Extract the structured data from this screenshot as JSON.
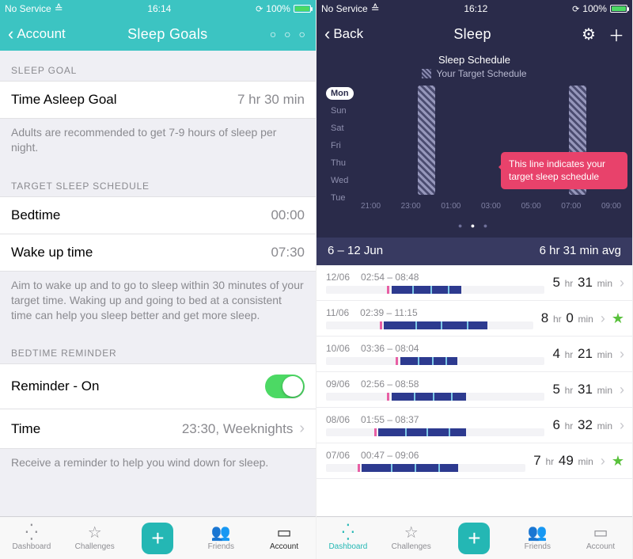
{
  "left": {
    "status": {
      "carrier": "No Service",
      "time": "16:14",
      "battery": "100%"
    },
    "nav": {
      "back": "Account",
      "title": "Sleep Goals"
    },
    "sections": {
      "sleep_goal_header": "Sleep Goal",
      "time_asleep_label": "Time Asleep Goal",
      "time_asleep_value": "7 hr 30 min",
      "sleep_goal_note": "Adults are recommended to get 7-9 hours of sleep per night.",
      "target_header": "Target Sleep Schedule",
      "bedtime_label": "Bedtime",
      "bedtime_value": "00:00",
      "wake_label": "Wake up time",
      "wake_value": "07:30",
      "target_note": "Aim to wake up and to go to sleep within 30 minutes of your target time. Waking up and going to bed at a consistent time can help you sleep better and get more sleep.",
      "reminder_header": "Bedtime Reminder",
      "reminder_label": "Reminder - On",
      "reminder_time_label": "Time",
      "reminder_time_value": "23:30, Weeknights",
      "reminder_note": "Receive a reminder to help you wind down for sleep."
    },
    "tabs": {
      "dashboard": "Dashboard",
      "challenges": "Challenges",
      "friends": "Friends",
      "account": "Account"
    }
  },
  "right": {
    "status": {
      "carrier": "No Service",
      "time": "16:12",
      "battery": "100%"
    },
    "nav": {
      "back": "Back",
      "title": "Sleep"
    },
    "panel": {
      "subtitle": "Sleep Schedule",
      "legend": "Your Target Schedule",
      "days": [
        "Mon",
        "Sun",
        "Sat",
        "Fri",
        "Thu",
        "Wed",
        "Tue"
      ],
      "xticks": [
        "21:00",
        "23:00",
        "01:00",
        "03:00",
        "05:00",
        "07:00",
        "09:00"
      ],
      "callout": "This line indicates your target sleep schedule",
      "summary_range": "6 – 12 Jun",
      "summary_avg": "6 hr 31 min avg"
    },
    "entries": [
      {
        "date": "12/06",
        "range": "02:54 – 08:48",
        "h": "5",
        "m": "31",
        "star": false,
        "start": 30,
        "len": 32
      },
      {
        "date": "11/06",
        "range": "02:39 – 11:15",
        "h": "8",
        "m": "0",
        "star": true,
        "start": 28,
        "len": 50
      },
      {
        "date": "10/06",
        "range": "03:36 – 08:04",
        "h": "4",
        "m": "21",
        "star": false,
        "start": 34,
        "len": 26
      },
      {
        "date": "09/06",
        "range": "02:56 – 08:58",
        "h": "5",
        "m": "31",
        "star": false,
        "start": 30,
        "len": 34
      },
      {
        "date": "08/06",
        "range": "01:55 – 08:37",
        "h": "6",
        "m": "32",
        "star": false,
        "start": 24,
        "len": 40
      },
      {
        "date": "07/06",
        "range": "00:47 – 09:06",
        "h": "7",
        "m": "49",
        "star": true,
        "start": 18,
        "len": 48
      }
    ],
    "tabs": {
      "dashboard": "Dashboard",
      "challenges": "Challenges",
      "friends": "Friends",
      "account": "Account"
    }
  },
  "chart_data": {
    "type": "bar",
    "title": "Sleep Schedule",
    "legend": "Your Target Schedule",
    "y_categories": [
      "Mon",
      "Sun",
      "Sat",
      "Fri",
      "Thu",
      "Wed",
      "Tue"
    ],
    "x_ticks_hours": [
      21,
      23,
      1,
      3,
      5,
      7,
      9
    ],
    "target_bedtime": "00:00",
    "target_wakeup": "07:30"
  }
}
